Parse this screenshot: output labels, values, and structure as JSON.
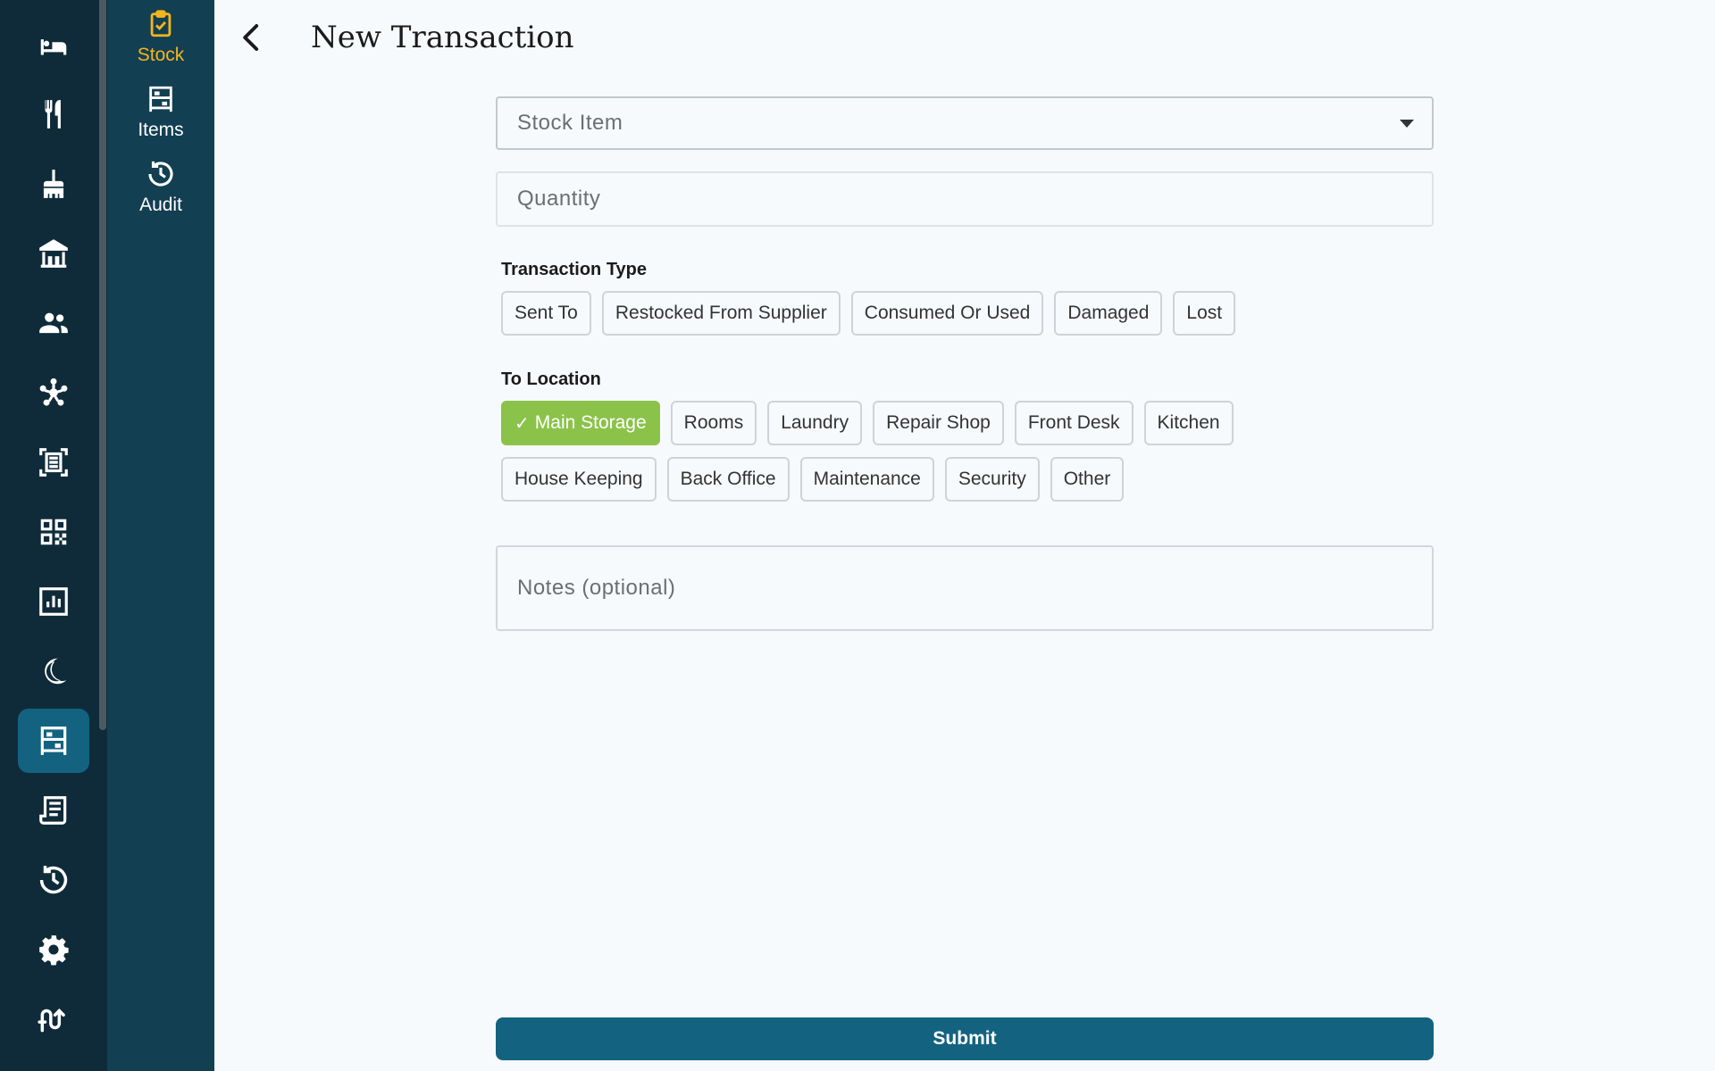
{
  "header": {
    "title": "New Transaction"
  },
  "subnav": {
    "items": [
      {
        "label": "Stock"
      },
      {
        "label": "Items"
      },
      {
        "label": "Audit"
      }
    ]
  },
  "form": {
    "stock_item_placeholder": "Stock Item",
    "quantity_placeholder": "Quantity",
    "notes_placeholder": "Notes (optional)",
    "transaction_type_label": "Transaction Type",
    "transaction_types": [
      "Sent To",
      "Restocked From Supplier",
      "Consumed Or Used",
      "Damaged",
      "Lost"
    ],
    "to_location_label": "To Location",
    "locations_row1": [
      "Main Storage",
      "Rooms",
      "Laundry",
      "Repair Shop",
      "Front Desk",
      "Kitchen"
    ],
    "locations_row2": [
      "House Keeping",
      "Back Office",
      "Maintenance",
      "Security",
      "Other"
    ],
    "selected_location": "Main Storage",
    "submit_label": "Submit"
  },
  "colors": {
    "rail_bg": "#0f2b3a",
    "subnav_bg": "#133f53",
    "accent": "#136380",
    "active_subnav": "#f3b51c",
    "selected_chip": "#8bc34a"
  }
}
